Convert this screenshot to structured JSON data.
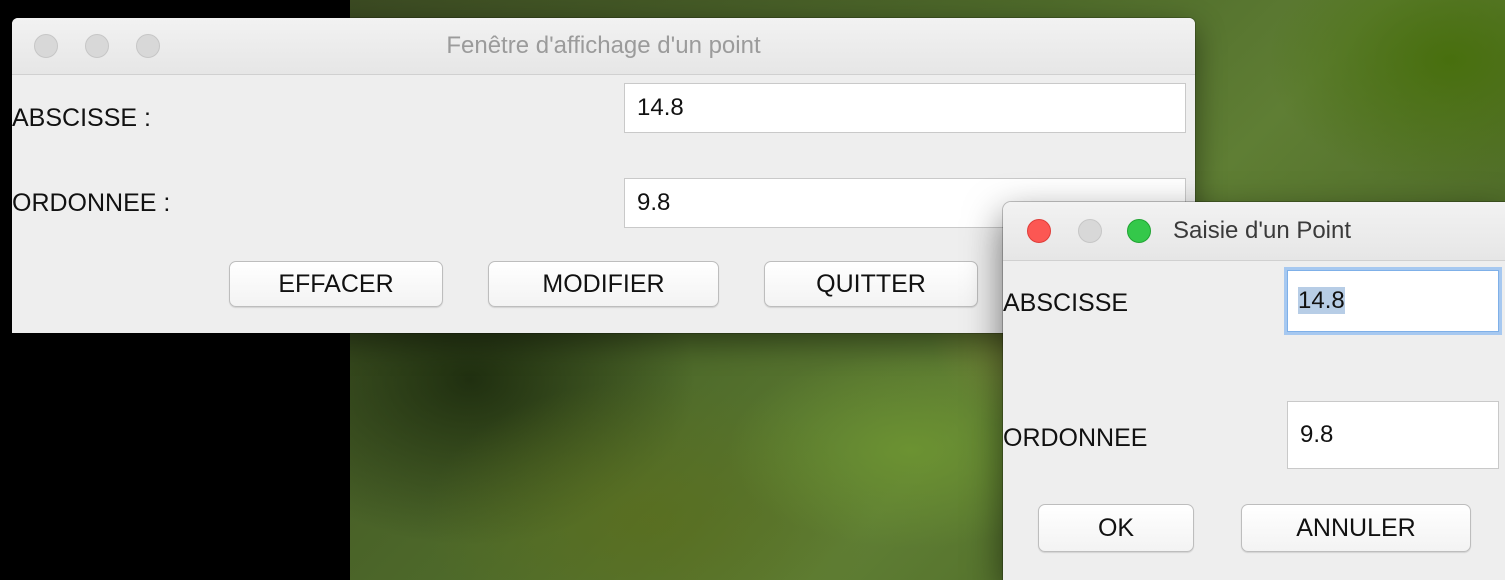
{
  "main_window": {
    "title": "Fenêtre d'affichage d'un point",
    "abscisse_label": "ABSCISSE :",
    "abscisse_value": "14.8",
    "ordonnee_label": "ORDONNEE :",
    "ordonnee_value": "9.8",
    "buttons": {
      "effacer": "EFFACER",
      "modifier": "MODIFIER",
      "quitter": "QUITTER"
    }
  },
  "dialog": {
    "title": "Saisie d'un Point",
    "abscisse_label": "ABSCISSE",
    "abscisse_value": "14.8",
    "ordonnee_label": "ORDONNEE",
    "ordonnee_value": "9.8",
    "buttons": {
      "ok": "OK",
      "annuler": "ANNULER"
    }
  },
  "colors": {
    "close_red": "#fc5753",
    "zoom_green": "#34c84a",
    "focus_ring": "#a6c8f0",
    "selection": "#b7cde6"
  }
}
